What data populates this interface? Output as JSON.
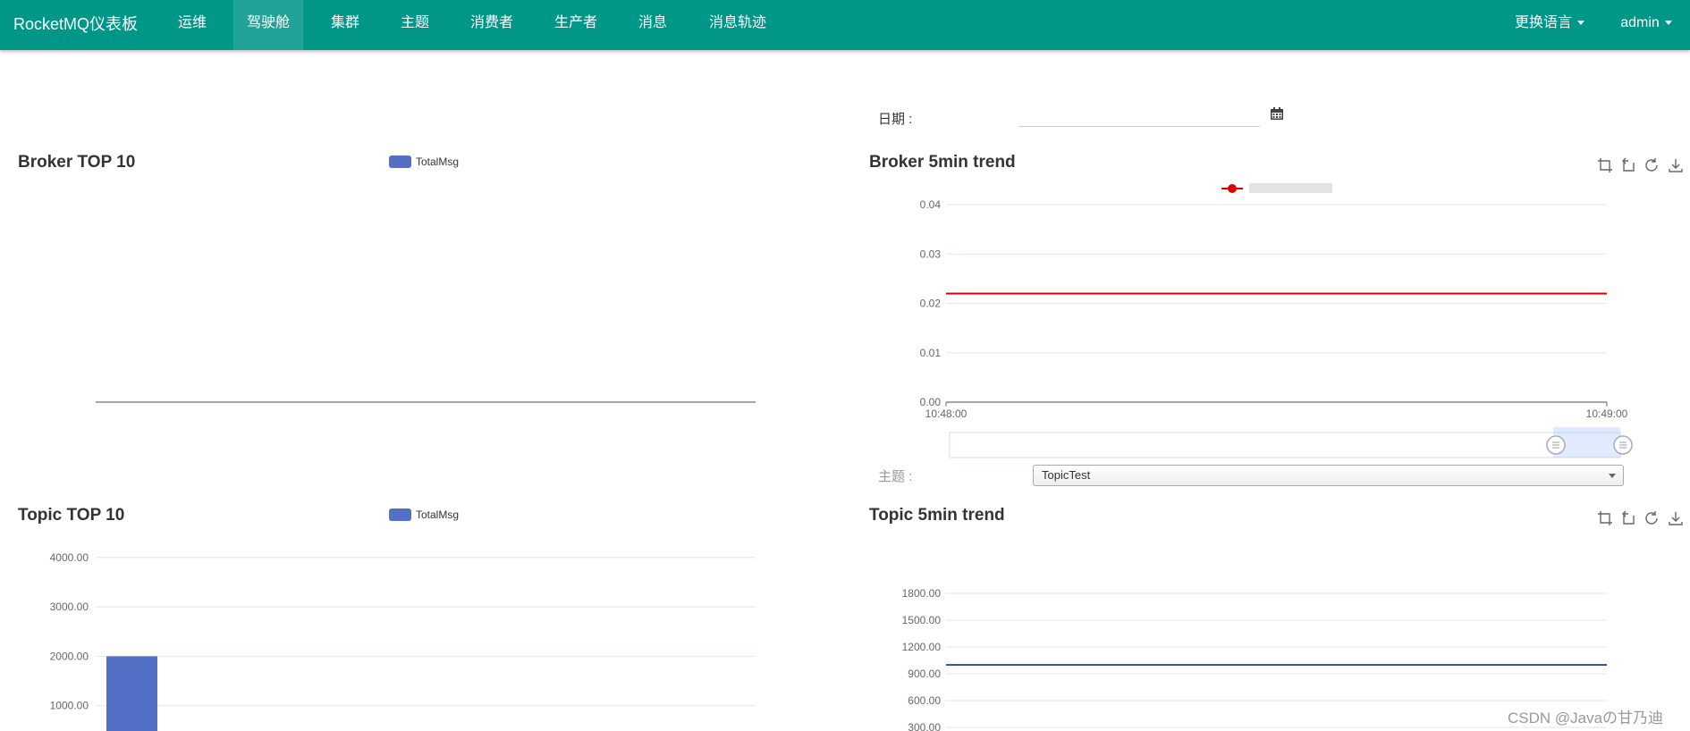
{
  "navbar": {
    "brand": "RocketMQ仪表板",
    "items": [
      "运维",
      "驾驶舱",
      "集群",
      "主题",
      "消费者",
      "生产者",
      "消息",
      "消息轨迹"
    ],
    "active_index": 1,
    "language_label": "更换语言",
    "user_label": "admin"
  },
  "date_form": {
    "label": "日期 :",
    "value": ""
  },
  "topic_form": {
    "label": "主题 :",
    "selected": "TopicTest"
  },
  "watermark": "CSDN @Javaの甘乃迪",
  "icons": {
    "toolbox": [
      "zoom-icon",
      "zoom-reset-icon",
      "restore-icon",
      "save-image-icon"
    ],
    "calendar": "calendar-icon"
  },
  "colors": {
    "navbar": "#009688",
    "bar_series": "#5470c6",
    "broker_trend_line": "#dd0000",
    "topic_trend_line": "#3355aa"
  },
  "chart_data": [
    {
      "id": "broker_top10",
      "title": "Broker TOP 10",
      "type": "bar",
      "legend": [
        "TotalMsg"
      ],
      "categories": [],
      "series": [
        {
          "name": "TotalMsg",
          "values": []
        }
      ]
    },
    {
      "id": "broker_trend",
      "title": "Broker 5min trend",
      "type": "line",
      "legend_position": "top-center",
      "x_ticks": [
        "10:48:00",
        "10:49:00"
      ],
      "y_ticks": [
        "0.00",
        "0.01",
        "0.02",
        "0.03",
        "0.04"
      ],
      "ylim": [
        0,
        0.04
      ],
      "series": [
        {
          "values": [
            0.022,
            0.022
          ]
        }
      ],
      "data_zoom": {
        "start": 0.9,
        "end": 1.0
      }
    },
    {
      "id": "topic_top10",
      "title": "Topic TOP 10",
      "type": "bar",
      "legend": [
        "TotalMsg"
      ],
      "y_ticks": [
        "1000.00",
        "2000.00",
        "3000.00",
        "4000.00"
      ],
      "ylim": [
        0,
        4000
      ],
      "series": [
        {
          "name": "TotalMsg",
          "values": [
            2000
          ]
        }
      ]
    },
    {
      "id": "topic_trend",
      "title": "Topic 5min trend",
      "type": "line",
      "y_ticks": [
        "300.00",
        "600.00",
        "900.00",
        "1200.00",
        "1500.00",
        "1800.00"
      ],
      "ylim": [
        0,
        1800
      ],
      "series": [
        {
          "values": [
            1000,
            1000
          ]
        }
      ]
    }
  ]
}
